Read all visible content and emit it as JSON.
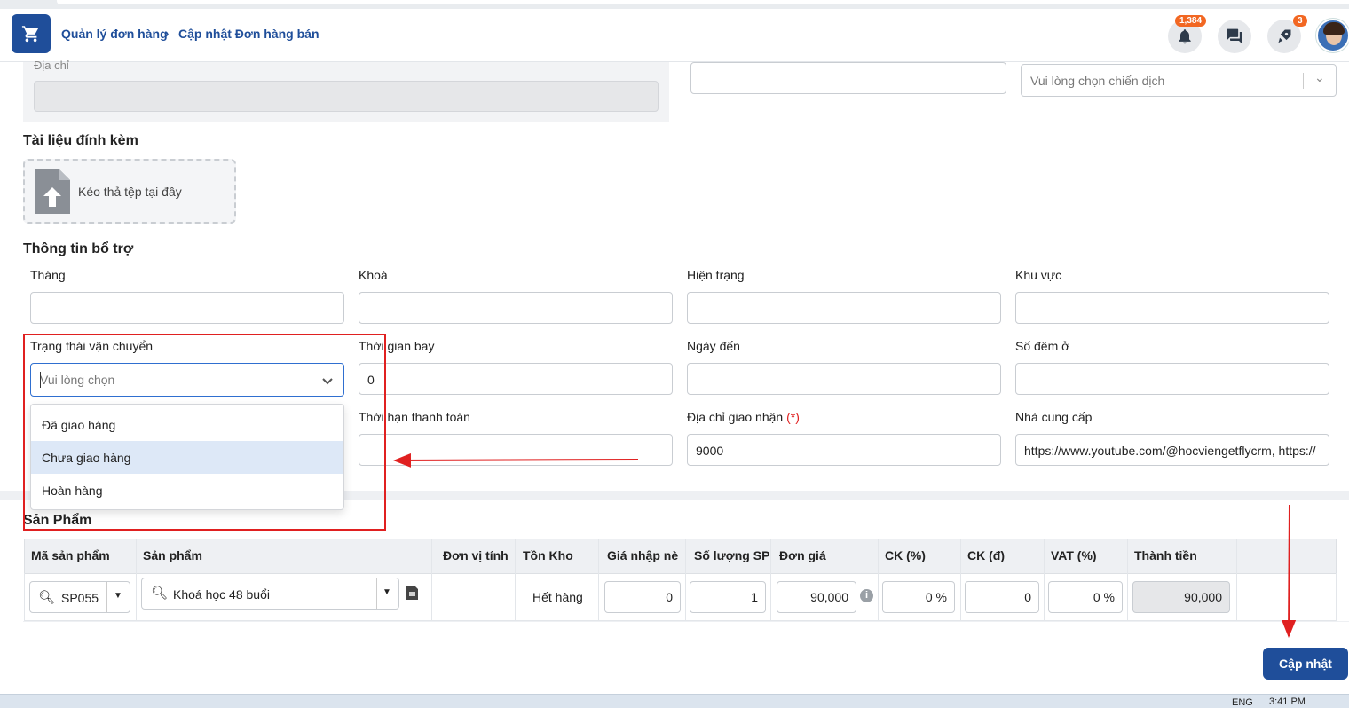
{
  "breadcrumb": {
    "parent": "Quản lý đơn hàng",
    "current": "Cập nhật Đơn hàng bán"
  },
  "header": {
    "notification_count": "1,384",
    "rocket_count": "3"
  },
  "address": {
    "label": "Địa chỉ"
  },
  "campaign": {
    "placeholder": "Vui lòng chọn chiến dịch"
  },
  "attachments": {
    "title": "Tài liệu đính kèm",
    "dropzone_text": "Kéo thả tệp tại đây"
  },
  "support": {
    "title": "Thông tin bổ trợ",
    "thang": {
      "label": "Tháng",
      "value": ""
    },
    "khoa": {
      "label": "Khoá",
      "value": ""
    },
    "hien_trang": {
      "label": "Hiện trạng",
      "value": ""
    },
    "khu_vuc": {
      "label": "Khu vực",
      "value": ""
    },
    "trang_thai": {
      "label": "Trạng thái vận chuyển",
      "placeholder": "Vui lòng chọn",
      "options": [
        "Đã giao hàng",
        "Chưa giao hàng",
        "Hoàn hàng"
      ],
      "highlighted": "Chưa giao hàng"
    },
    "thoi_gian_bay": {
      "label": "Thời gian bay",
      "value": "0"
    },
    "ngay_den": {
      "label": "Ngày đến",
      "value": ""
    },
    "so_dem": {
      "label": "Số đêm ở",
      "value": ""
    },
    "thoi_han": {
      "label": "Thời hạn thanh toán",
      "value": ""
    },
    "dia_chi_giao": {
      "label": "Địa chỉ giao nhận",
      "required": "(*)",
      "value": "9000"
    },
    "nha_cung_cap": {
      "label": "Nhà cung cấp",
      "value": "https://www.youtube.com/@hocviengetflycrm, https://"
    }
  },
  "products": {
    "title": "Sản Phẩm",
    "columns": [
      "Mã sản phẩm",
      "Sản phẩm",
      "Đơn vị tính",
      "Tồn Kho",
      "Giá nhập nè",
      "Số lượng SP",
      "Đơn giá",
      "CK (%)",
      "CK (đ)",
      "VAT (%)",
      "Thành tiền"
    ],
    "row": {
      "code": "SP055",
      "name": "Khoá học 48 buổi",
      "unit": "",
      "stock": "Hết hàng",
      "import_price": "0",
      "quantity": "1",
      "unit_price": "90,000",
      "ck_pct": "0 %",
      "ck_amount": "0",
      "vat": "0 %",
      "total": "90,000"
    }
  },
  "actions": {
    "update_label": "Cập nhật"
  },
  "taskbar": {
    "lang": "ENG",
    "time": "3:41 PM"
  },
  "colors": {
    "primary": "#1f4e9a",
    "annotation": "#e02020",
    "badge": "#f26722"
  }
}
